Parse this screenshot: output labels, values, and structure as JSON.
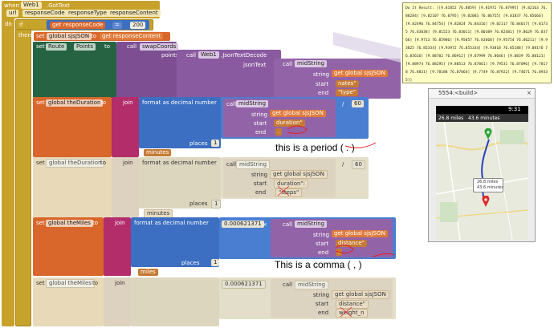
{
  "event": {
    "when": "when",
    "component": "Web1",
    "event_name": ".GotText",
    "params": [
      "url",
      "responseCode",
      "responseType",
      "responseContent"
    ],
    "do": "do"
  },
  "if_block": {
    "if": "if",
    "then": "then",
    "get": "get",
    "var": "responseCode",
    "op": "=",
    "value": "200"
  },
  "set_sjson": {
    "set": "set",
    "var": "global sjsJSON",
    "to": "to",
    "get": "get",
    "val": "responseContent"
  },
  "set_route": {
    "set": "set",
    "component": "Route",
    "prop": "Points",
    "to": "to",
    "call": "call",
    "proc": "swapCoords",
    "points": "points",
    "web": "Web1",
    "method": ".JsonTextDecode",
    "jsonText": "jsonText",
    "midString": "midString",
    "string": "string",
    "start": "start",
    "end": "end",
    "get": "get",
    "gvar": "global sjsJSON",
    "start_val": "nates\"",
    "end_val": "\"type\""
  },
  "duration1": {
    "set": "set",
    "var": "global theDuration",
    "to": "to",
    "join": "join",
    "format": "format as decimal number",
    "call": "call",
    "midString": "midString",
    "string": "string",
    "start": "start",
    "end": "end",
    "get": "get",
    "gvar": "global sjsJSON",
    "start_val": "duration\"",
    "end_val": ".",
    "divisor": "60",
    "divop": "/",
    "places": "places",
    "places_val": "1",
    "suffix": "minutes"
  },
  "duration2": {
    "set": "set",
    "var": "global theDuration",
    "to": "to",
    "join": "join",
    "format": "format as decimal number",
    "call": "call",
    "midString": "midString",
    "string": "string",
    "start": "start",
    "end": "end",
    "get": "get",
    "gvar": "global sjsJSON",
    "start_val": "duration\":",
    "end_val": "\"steps\"",
    "divisor": "60",
    "divop": "/",
    "places": "places",
    "places_val": "1",
    "suffix": "minutes"
  },
  "miles1": {
    "set": "set",
    "var": "global theMiles",
    "to": "to",
    "join": "join",
    "format": "format as decimal number",
    "factor": "0.000621371",
    "mulop": "×",
    "call": "call",
    "midString": "midString",
    "string": "string",
    "start": "start",
    "end": "end",
    "get": "get",
    "gvar": "global sjsJSON",
    "start_val": "distance\"",
    "end_val": ",",
    "places": "places",
    "places_val": "1",
    "suffix": "miles"
  },
  "miles2": {
    "set": "set",
    "var": "global theMiles",
    "to": "to",
    "join": "join",
    "factor": "0.000621371",
    "call": "call",
    "midString": "midString",
    "string": "string",
    "start": "start",
    "end": "end",
    "get": "get",
    "gvar": "global sjsJSON",
    "start_val": "distance\"",
    "end_val": "weight_n"
  },
  "annotations": {
    "period": "this is a period (   .   )",
    "comma": "This is a comma  (     ,    )"
  },
  "tooltip": {
    "text": "Do It Result: [[9.81852 76.8859] [9.81972 76.87995] [9.82163 76.88284] [9.82107 76.8795] [9.82083 76.86755] [9.81837 76.85666] [9.82496 76.84754] [9.82824 76.84316] [9.82117 76.84017] [9.81735 76.83838] [9.81523 76.83011] [9.80389 76.82481] [9.8629 76.83766] [9.9713 76.85986] [9.95057 76.83668] [9.95754 76.86211] [9.93825 76.85334] [9.93972 76.855334] [9.93818 76.85188] [9.88176 76.83616] [9.88702 76.86912] [9.87999 76.8646] [9.8839 76.88121] [9.88974 76.88295] [9.88513 76.87861] [9.79531 76.87096] [9.78178 76.8831] [9.78188 76.87864] [9.7749 76.87922] [9.74671 76.89335]]"
  },
  "phone": {
    "window_title": "5554:<build>",
    "time": "9:31",
    "header_miles": "26.8 miles",
    "header_minutes": "43.6 minutes",
    "bubble_line1": "26.8 miles",
    "bubble_line2": "43.6 minutes",
    "colors": {
      "route": "#2f3fb8",
      "start_pin": "#2ea53a",
      "end_pin": "#e02a2a"
    }
  }
}
